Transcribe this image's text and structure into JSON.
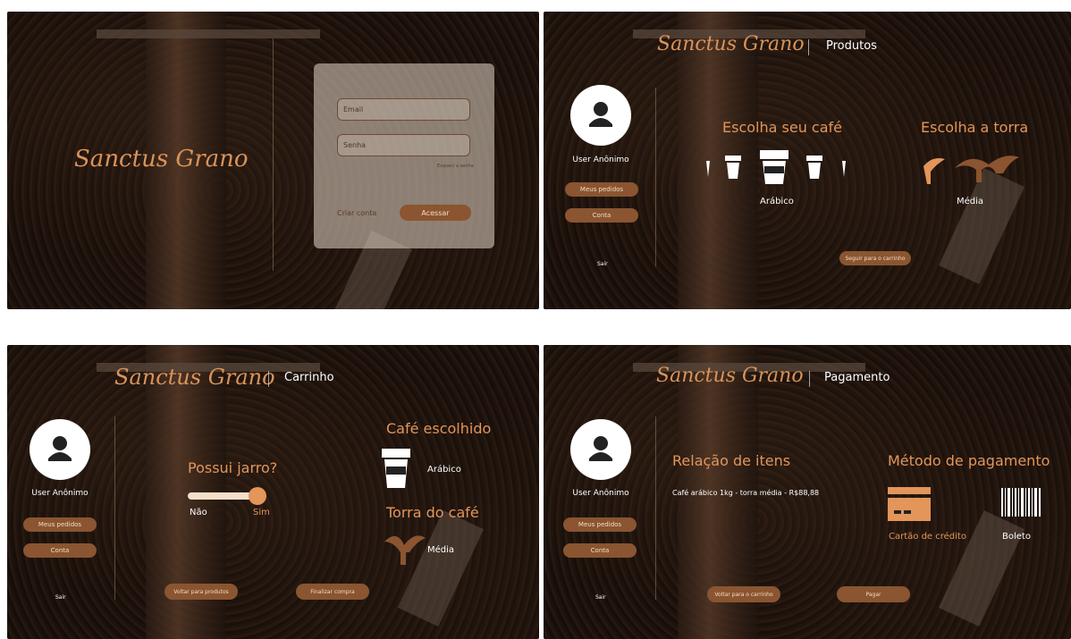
{
  "brand": "Sanctus Grano",
  "login": {
    "email_placeholder": "Email",
    "password_placeholder": "Senha",
    "forgot": "Esqueci a senha",
    "create": "Criar conta",
    "access": "Acessar"
  },
  "sidebar": {
    "user": "User Anônimo",
    "orders": "Meus pedidos",
    "account": "Conta",
    "logout": "Sair"
  },
  "produtos": {
    "title": "Produtos",
    "choose_coffee": "Escolha seu café",
    "coffee_selected": "Arábico",
    "choose_roast": "Escolha a torra",
    "roast_selected": "Média",
    "go_cart": "Seguir para o carrinho"
  },
  "carrinho": {
    "title": "Carrinho",
    "jar_question": "Possui jarro?",
    "no": "Não",
    "yes": "Sim",
    "jar_value": 1,
    "coffee_heading": "Café escolhido",
    "coffee": "Arábico",
    "roast_heading": "Torra do café",
    "roast": "Média",
    "back": "Voltar para produtos",
    "finish": "Finalizar compra"
  },
  "pagamento": {
    "title": "Pagamento",
    "items_heading": "Relação de itens",
    "item": "Café arábico 1kg - torra média - R$88,88",
    "method_heading": "Método de pagamento",
    "card": "Cartão de crédito",
    "boleto": "Boleto",
    "back": "Voltar para o carrinho",
    "pay": "Pagar"
  },
  "colors": {
    "accent": "#e3955a",
    "button": "#8a5530"
  }
}
